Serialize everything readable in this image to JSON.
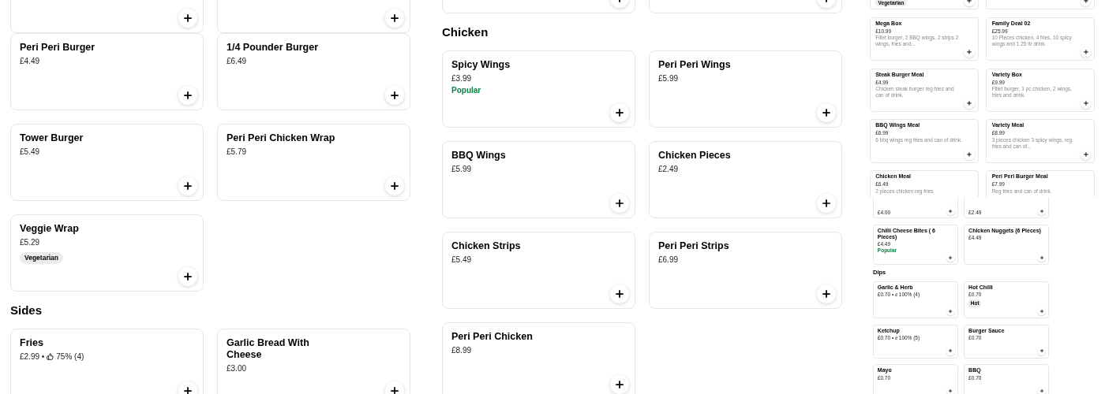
{
  "views": [
    {
      "sections": [
        {
          "items": [
            {
              "kind": "partial"
            },
            {
              "kind": "partial"
            }
          ]
        },
        {
          "items": [
            {
              "kind": "item",
              "name": "Peri Peri Burger",
              "price": "£4.49"
            },
            {
              "kind": "item",
              "name": "1/4 Pounder Burger",
              "price": "£6.49"
            },
            {
              "kind": "item",
              "name": "Tower Burger",
              "price": "£5.49"
            },
            {
              "kind": "item",
              "name": "Peri Peri Chicken Wrap",
              "price": "£5.79"
            },
            {
              "kind": "item",
              "name": "Veggie Wrap",
              "price": "£5.29",
              "badge": "Vegetarian"
            }
          ]
        },
        {
          "title": "Sides",
          "items": [
            {
              "kind": "item",
              "name": "Fries",
              "price": "£2.99 •",
              "rating": "75% (4)"
            },
            {
              "kind": "item",
              "name": "Garlic Bread With Cheese",
              "price": "£3.00"
            }
          ]
        }
      ]
    },
    {
      "sections": [
        {
          "items": [
            {
              "kind": "partial"
            },
            {
              "kind": "partial"
            }
          ]
        },
        {
          "title": "Chicken",
          "items": [
            {
              "kind": "item",
              "name": "Spicy Wings",
              "price": "£3.99",
              "popular": "Popular"
            },
            {
              "kind": "item",
              "name": "Peri Peri Wings",
              "price": "£5.99"
            },
            {
              "kind": "item",
              "name": "BBQ Wings",
              "price": "£5.99"
            },
            {
              "kind": "item",
              "name": "Chicken Pieces",
              "price": "£2.49"
            },
            {
              "kind": "item",
              "name": "Chicken Strips",
              "price": "£5.49"
            },
            {
              "kind": "item",
              "name": "Peri Peri Strips",
              "price": "£6.99"
            },
            {
              "kind": "item",
              "name": "Peri Peri Chicken",
              "price": "£8.99"
            }
          ]
        }
      ]
    },
    {
      "sections": [
        {
          "items": [
            {
              "kind": "partial",
              "badge": "Vegetarian"
            },
            {
              "kind": "partial"
            }
          ]
        },
        {
          "items": [
            {
              "kind": "item",
              "name": "Mega Box",
              "price": "£10.99",
              "description": "Fillet burger, 2 BBQ wings, 2 strips 2 wings, fries and..."
            },
            {
              "kind": "item",
              "name": "Family Deal 02",
              "price": "£25.99",
              "description": "10 Pieces chicken, 4 fries, 10 spicy wings and 1.25 ltr drink."
            },
            {
              "kind": "item",
              "name": "Steak Burger Meal",
              "price": "£4.99",
              "description": "Chicken steak burger reg fries and can of drink."
            },
            {
              "kind": "item",
              "name": "Variety Box",
              "price": "£9.99",
              "description": "Fillet burger, 1 pc chicken, 2 wings, fries and drink."
            },
            {
              "kind": "item",
              "name": "BBQ Wings Meal",
              "price": "£6.99",
              "description": "6 bbq wings reg fries and can of drink."
            },
            {
              "kind": "item",
              "name": "Variety Meal",
              "price": "£8.99",
              "description": "3 pieces chicken 3 spicy wings, reg fries and can of..."
            },
            {
              "kind": "clipped",
              "name": "Chicken Meal",
              "price": "£6.49",
              "description": "2 pieces chicken reg fries"
            },
            {
              "kind": "clipped",
              "name": "Peri Peri Burger Meal",
              "price": "£7.99",
              "description": "Reg fries and can of drink."
            }
          ]
        }
      ]
    },
    {
      "sections": [
        {
          "items": [
            {
              "kind": "partial",
              "price": "£4.00"
            },
            {
              "kind": "partial",
              "price": "£2.49"
            },
            {
              "kind": "item",
              "name": "Chilli Cheese Bites ( 6 Pieces)",
              "price": "£4.49",
              "popular": "Popular"
            },
            {
              "kind": "item",
              "name": "Chicken Nuggets (6 Pieces)",
              "price": "£4.49"
            }
          ]
        },
        {
          "title": "Dips",
          "items": [
            {
              "kind": "item",
              "name": "Garlic & Herb",
              "price": "£0.70 •",
              "rating": "100% (4)"
            },
            {
              "kind": "item",
              "name": "Hot Chilli",
              "price": "£0.70",
              "badge": "Hot"
            },
            {
              "kind": "item",
              "name": "Ketchup",
              "price": "£0.70 •",
              "rating": "100% (5)"
            },
            {
              "kind": "item",
              "name": "Burger Sauce",
              "price": "£0.70"
            },
            {
              "kind": "item",
              "name": "Mayo",
              "price": "£0.70"
            },
            {
              "kind": "item",
              "name": "BBQ",
              "price": "£0.70"
            }
          ]
        }
      ]
    }
  ]
}
